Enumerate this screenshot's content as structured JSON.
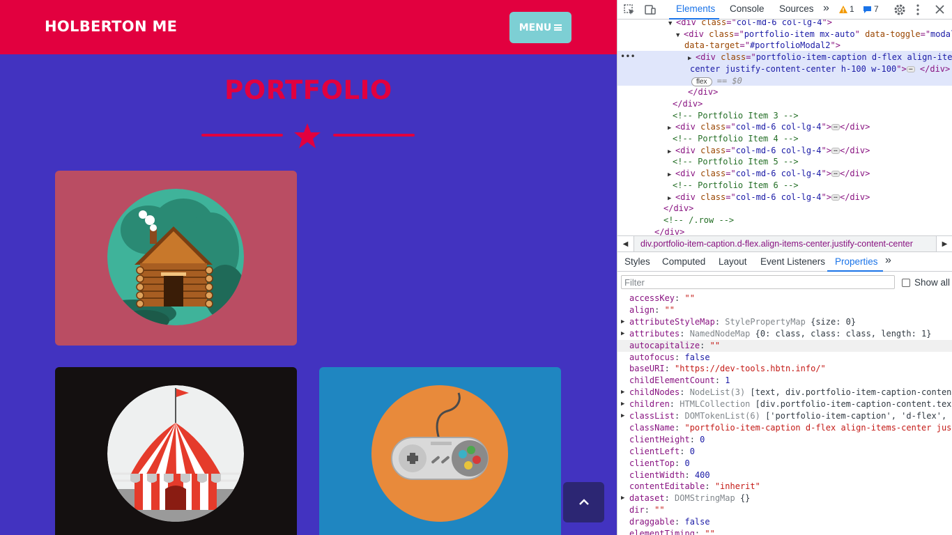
{
  "site": {
    "brand": "HOLBERTON ME",
    "menu_label": "MENU",
    "section_title": "PORTFOLIO"
  },
  "devtools": {
    "tabs": [
      "Elements",
      "Console",
      "Sources"
    ],
    "warnings_count": "1",
    "messages_count": "7",
    "dom_lines": [
      {
        "indent": 0,
        "tri": "open",
        "parts": [
          [
            "tag",
            "<div "
          ],
          [
            "an",
            "class"
          ],
          [
            "tag",
            "=\""
          ],
          [
            "av",
            "col-md-6 col-lg-4"
          ],
          [
            "tag",
            "\">"
          ]
        ]
      },
      {
        "indent": 1,
        "tri": "open",
        "parts": [
          [
            "tag",
            "<div "
          ],
          [
            "an",
            "class"
          ],
          [
            "tag",
            "=\""
          ],
          [
            "av",
            "portfolio-item mx-auto"
          ],
          [
            "tag",
            "\" "
          ],
          [
            "an",
            "data-toggle"
          ],
          [
            "tag",
            "=\""
          ],
          [
            "av",
            "modal"
          ],
          [
            "tag",
            "\""
          ]
        ]
      },
      {
        "indent": 2,
        "tri": "none",
        "parts": [
          [
            "an",
            "data-target"
          ],
          [
            "tag",
            "=\""
          ],
          [
            "av",
            "#portfolioModal2"
          ],
          [
            "tag",
            "\">"
          ]
        ]
      },
      {
        "indent": 2,
        "tri": "closed",
        "parts": [
          [
            "tag",
            "<div "
          ],
          [
            "an",
            "class"
          ],
          [
            "tag",
            "=\""
          ],
          [
            "av",
            "portfolio-item-caption d-flex align-items-"
          ]
        ]
      },
      {
        "indent": 3,
        "tri": "none",
        "parts": [
          [
            "av",
            "center justify-content-center h-100 w-100"
          ],
          [
            "tag",
            "\">"
          ],
          [
            "ell",
            ""
          ],
          [
            "tag",
            " </div>"
          ]
        ]
      },
      {
        "indent": 3,
        "tri": "none",
        "parts": [
          [
            "flex",
            "flex"
          ],
          [
            "dollar",
            " == $0"
          ]
        ]
      },
      {
        "indent": 2,
        "tri": "none",
        "parts": [
          [
            "tag",
            "</div>"
          ]
        ]
      },
      {
        "indent": 1,
        "tri": "none",
        "parts": [
          [
            "tag",
            "</div>"
          ]
        ]
      },
      {
        "indent": 1,
        "tri": "none",
        "parts": [
          [
            "cm",
            "<!-- Portfolio Item 3 -->"
          ]
        ]
      },
      {
        "indent": 1,
        "tri": "closed",
        "parts": [
          [
            "tag",
            "<div "
          ],
          [
            "an",
            "class"
          ],
          [
            "tag",
            "=\""
          ],
          [
            "av",
            "col-md-6 col-lg-4"
          ],
          [
            "tag",
            "\">"
          ],
          [
            "ell",
            ""
          ],
          [
            "tag",
            "</div>"
          ]
        ]
      },
      {
        "indent": 1,
        "tri": "none",
        "parts": [
          [
            "cm",
            "<!-- Portfolio Item 4 -->"
          ]
        ]
      },
      {
        "indent": 1,
        "tri": "closed",
        "parts": [
          [
            "tag",
            "<div "
          ],
          [
            "an",
            "class"
          ],
          [
            "tag",
            "=\""
          ],
          [
            "av",
            "col-md-6 col-lg-4"
          ],
          [
            "tag",
            "\">"
          ],
          [
            "ell",
            ""
          ],
          [
            "tag",
            "</div>"
          ]
        ]
      },
      {
        "indent": 1,
        "tri": "none",
        "parts": [
          [
            "cm",
            "<!-- Portfolio Item 5 -->"
          ]
        ]
      },
      {
        "indent": 1,
        "tri": "closed",
        "parts": [
          [
            "tag",
            "<div "
          ],
          [
            "an",
            "class"
          ],
          [
            "tag",
            "=\""
          ],
          [
            "av",
            "col-md-6 col-lg-4"
          ],
          [
            "tag",
            "\">"
          ],
          [
            "ell",
            ""
          ],
          [
            "tag",
            "</div>"
          ]
        ]
      },
      {
        "indent": 1,
        "tri": "none",
        "parts": [
          [
            "cm",
            "<!-- Portfolio Item 6 -->"
          ]
        ]
      },
      {
        "indent": 1,
        "tri": "closed",
        "parts": [
          [
            "tag",
            "<div "
          ],
          [
            "an",
            "class"
          ],
          [
            "tag",
            "=\""
          ],
          [
            "av",
            "col-md-6 col-lg-4"
          ],
          [
            "tag",
            "\">"
          ],
          [
            "ell",
            ""
          ],
          [
            "tag",
            "</div>"
          ]
        ]
      },
      {
        "indent": 0,
        "tri": "none",
        "parts": [
          [
            "tag",
            "</div>"
          ]
        ]
      },
      {
        "indent": 0,
        "tri": "none",
        "parts": [
          [
            "cm",
            "<!-- /.row -->"
          ]
        ]
      },
      {
        "indent": -1,
        "tri": "none",
        "parts": [
          [
            "tag",
            "</div>"
          ]
        ]
      }
    ],
    "breadcrumb": "div.portfolio-item-caption.d-flex.align-items-center.justify-content-center",
    "sub_tabs": [
      "Styles",
      "Computed",
      "Layout",
      "Event Listeners",
      "Properties"
    ],
    "filter_placeholder": "Filter",
    "show_all_label": "Show all",
    "properties": [
      {
        "tri": false,
        "key": "accessKey",
        "kind": "str",
        "value": "\"\""
      },
      {
        "tri": false,
        "key": "align",
        "kind": "str",
        "value": "\"\""
      },
      {
        "tri": true,
        "key": "attributeStyleMap",
        "kind": "obj",
        "value": "StylePropertyMap",
        "extra": " {size: 0}"
      },
      {
        "tri": true,
        "key": "attributes",
        "kind": "obj",
        "value": "NamedNodeMap",
        "extra": " {0: class, class: class, length: 1}"
      },
      {
        "tri": false,
        "key": "autocapitalize",
        "kind": "str",
        "value": "\"\"",
        "hl": true
      },
      {
        "tri": false,
        "key": "autofocus",
        "kind": "bool",
        "value": "false"
      },
      {
        "tri": false,
        "key": "baseURI",
        "kind": "str",
        "value": "\"https://dev-tools.hbtn.info/\""
      },
      {
        "tri": false,
        "key": "childElementCount",
        "kind": "num",
        "value": "1"
      },
      {
        "tri": true,
        "key": "childNodes",
        "kind": "obj",
        "value": "NodeList(3)",
        "extra": " [text, div.portfolio-item-caption-content.t"
      },
      {
        "tri": true,
        "key": "children",
        "kind": "obj",
        "value": "HTMLCollection",
        "extra": " [div.portfolio-item-caption-content.text-c"
      },
      {
        "tri": true,
        "key": "classList",
        "kind": "obj",
        "value": "DOMTokenList(6)",
        "extra": " ['portfolio-item-caption', 'd-flex', 'al"
      },
      {
        "tri": false,
        "key": "className",
        "kind": "str",
        "value": "\"portfolio-item-caption d-flex align-items-center justif"
      },
      {
        "tri": false,
        "key": "clientHeight",
        "kind": "num",
        "value": "0"
      },
      {
        "tri": false,
        "key": "clientLeft",
        "kind": "num",
        "value": "0"
      },
      {
        "tri": false,
        "key": "clientTop",
        "kind": "num",
        "value": "0"
      },
      {
        "tri": false,
        "key": "clientWidth",
        "kind": "num",
        "value": "400"
      },
      {
        "tri": false,
        "key": "contentEditable",
        "kind": "str",
        "value": "\"inherit\""
      },
      {
        "tri": true,
        "key": "dataset",
        "kind": "obj",
        "value": "DOMStringMap",
        "extra": " {}"
      },
      {
        "tri": false,
        "key": "dir",
        "kind": "str",
        "value": "\"\""
      },
      {
        "tri": false,
        "key": "draggable",
        "kind": "bool",
        "value": "false"
      },
      {
        "tri": false,
        "key": "elementTiming",
        "kind": "str",
        "value": "\"\""
      }
    ]
  },
  "colors": {
    "navbar": "#e2003f",
    "page_background": "#4233c0",
    "menu_button": "#7dcfd4",
    "accent_link": "#1a73e8"
  }
}
